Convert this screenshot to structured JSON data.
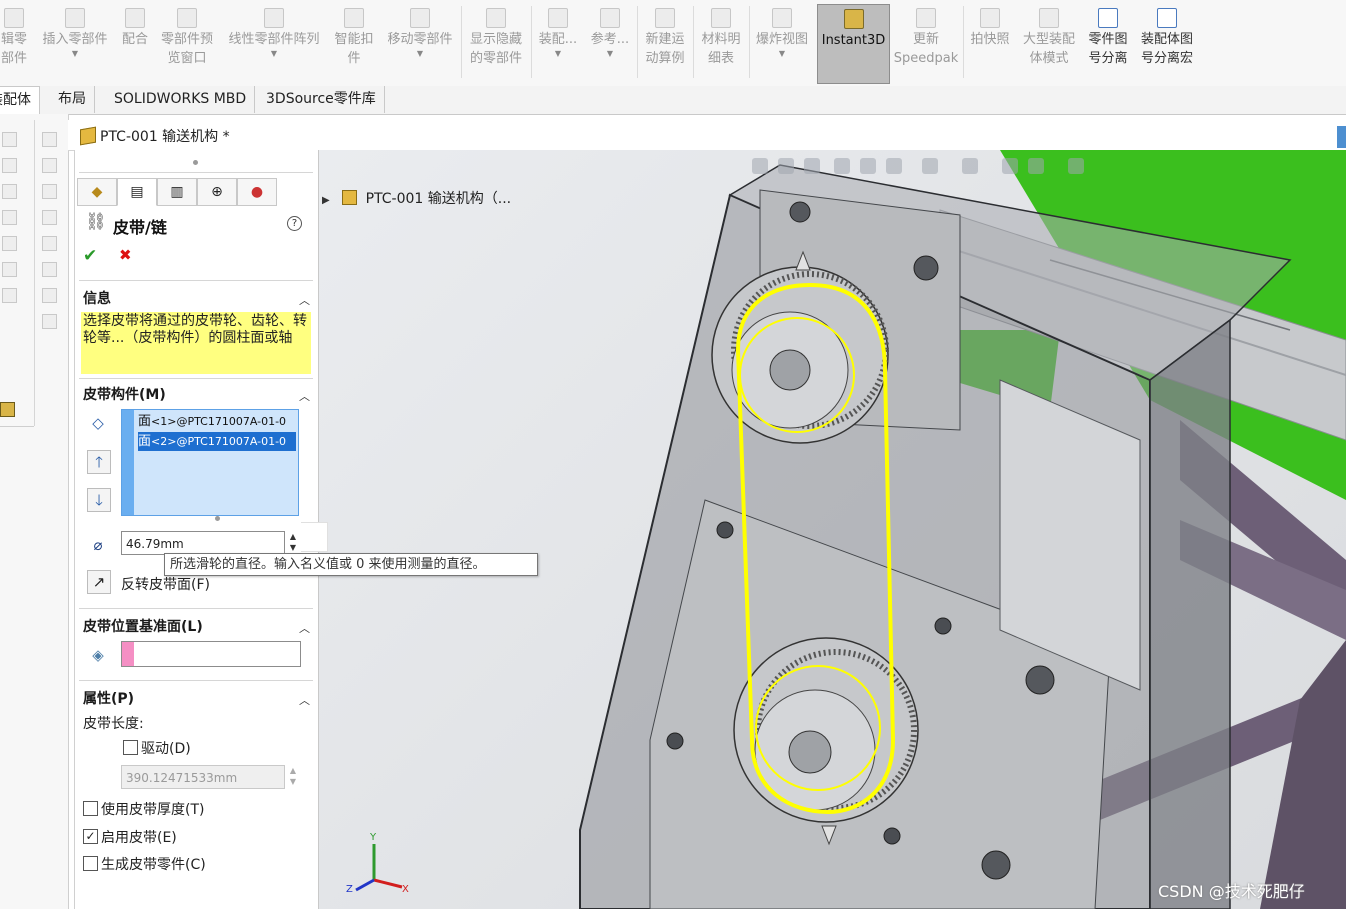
{
  "ribbon": {
    "items": [
      {
        "label": "辑零\n部件"
      },
      {
        "label": "插入零部件",
        "dropdown": true
      },
      {
        "label": "配合"
      },
      {
        "label": "零部件预\n览窗口"
      },
      {
        "label": "线性零部件阵列",
        "dropdown": true
      },
      {
        "label": "智能扣\n件"
      },
      {
        "label": "移动零部件",
        "dropdown": true
      },
      {
        "label": "显示隐藏\n的零部件"
      },
      {
        "label": "装配...",
        "dropdown": true
      },
      {
        "label": "参考...",
        "dropdown": true
      },
      {
        "label": "新建运\n动算例"
      },
      {
        "label": "材料明\n细表"
      },
      {
        "label": "爆炸视图",
        "dropdown": true
      },
      {
        "label": "Instant3D",
        "active": true
      },
      {
        "label": "更新\nSpeedpak"
      },
      {
        "label": "拍快照"
      },
      {
        "label": "大型装配\n体模式"
      },
      {
        "label": "零件图\n号分离"
      },
      {
        "label": "装配体图\n号分离宏"
      }
    ]
  },
  "tabs": [
    {
      "label": "装配体",
      "active": true
    },
    {
      "label": "布局"
    },
    {
      "label": "SOLIDWORKS MBD"
    },
    {
      "label": "3DSource零件库"
    }
  ],
  "document": {
    "title": "PTC-001 输送机构 *",
    "tree_item": "PTC-001 输送机构（..."
  },
  "pm": {
    "feature_title": "皮带/链",
    "help_icon": "?",
    "ok_icon": "✔",
    "cancel_icon": "✖",
    "info": {
      "header": "信息",
      "text": "选择皮带将通过的皮带轮、齿轮、转轮等...（皮带构件）的圆柱面或轴"
    },
    "members": {
      "header": "皮带构件(M)",
      "items": [
        {
          "prefix": "面",
          "text": "<1>@PTC171007A-01-0",
          "selected": false
        },
        {
          "prefix": "面",
          "text": "<2>@PTC171007A-01-0",
          "selected": true
        }
      ],
      "diameter_value": "46.79mm",
      "flip_label": "反转皮带面(F)"
    },
    "plane": {
      "header": "皮带位置基准面(L)",
      "value": ""
    },
    "props": {
      "header": "属性(P)",
      "length_label": "皮带长度:",
      "drive_label": "驱动(D)",
      "drive_checked": false,
      "length_value": "390.12471533mm",
      "thickness_label": "使用皮带厚度(T)",
      "thickness_checked": false,
      "enable_label": "启用皮带(E)",
      "enable_checked": true,
      "part_label": "生成皮带零件(C)",
      "part_checked": false
    }
  },
  "tooltip": "所选滑轮的直径。输入名义值或 0 来使用测量的直径。",
  "triad": {
    "x": "X",
    "y": "Y",
    "z": "Z"
  },
  "watermark": "CSDN @技术死肥仔",
  "colors": {
    "belt": "#ffff00",
    "conveyor_green": "#3bbf1e",
    "frame_purple": "#6d5f77",
    "info_yellow": "#ffff80",
    "selection_blue": "#1e6fd0",
    "plane_pink": "#f58fc4"
  }
}
